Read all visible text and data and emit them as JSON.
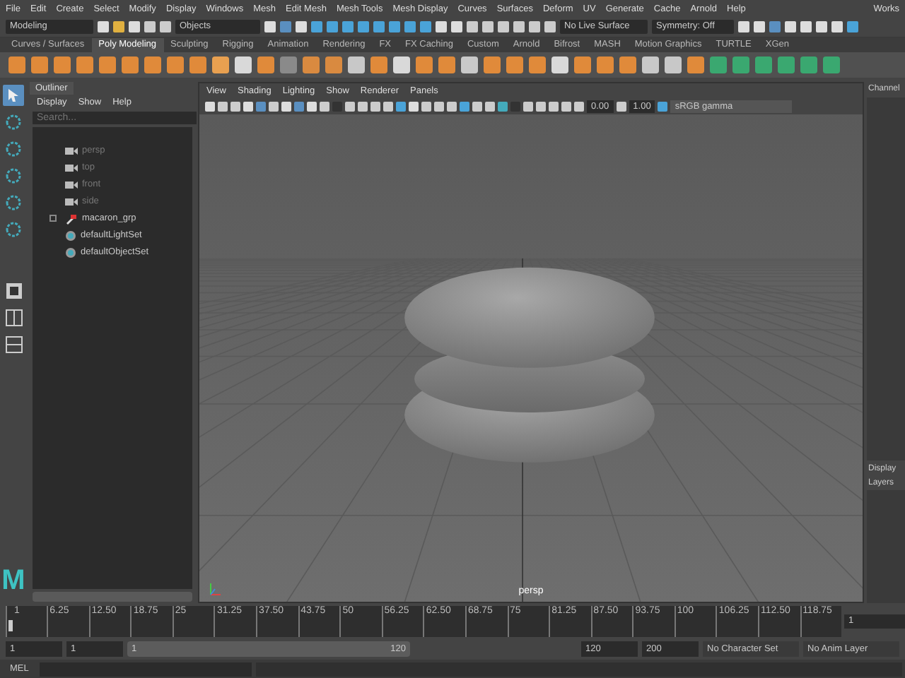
{
  "menu_bar": {
    "items": [
      "File",
      "Edit",
      "Create",
      "Select",
      "Modify",
      "Display",
      "Windows",
      "Mesh",
      "Edit Mesh",
      "Mesh Tools",
      "Mesh Display",
      "Curves",
      "Surfaces",
      "Deform",
      "UV",
      "Generate",
      "Cache",
      "Arnold",
      "Help"
    ],
    "workspace": "Works"
  },
  "status_line": {
    "menu_set": "Modeling",
    "selection_mode": "Objects",
    "live_surface": "No Live Surface",
    "symmetry": "Symmetry: Off"
  },
  "shelf": {
    "tabs": [
      {
        "label": "Curves / Surfaces",
        "selected": false
      },
      {
        "label": "Poly Modeling",
        "selected": true
      },
      {
        "label": "Sculpting",
        "selected": false
      },
      {
        "label": "Rigging",
        "selected": false
      },
      {
        "label": "Animation",
        "selected": false
      },
      {
        "label": "Rendering",
        "selected": false
      },
      {
        "label": "FX",
        "selected": false
      },
      {
        "label": "FX Caching",
        "selected": false
      },
      {
        "label": "Custom",
        "selected": false
      },
      {
        "label": "Arnold",
        "selected": false
      },
      {
        "label": "Bifrost",
        "selected": false
      },
      {
        "label": "MASH",
        "selected": false
      },
      {
        "label": "Motion Graphics",
        "selected": false
      },
      {
        "label": "TURTLE",
        "selected": false
      },
      {
        "label": "XGen",
        "selected": false
      }
    ]
  },
  "toolbox": {
    "tools": [
      {
        "selected": true
      },
      {
        "selected": false
      },
      {
        "selected": false
      },
      {
        "selected": false
      },
      {
        "selected": false
      },
      {
        "selected": false
      }
    ],
    "logo": "M"
  },
  "outliner": {
    "title": "Outliner",
    "menus": [
      "Display",
      "Show",
      "Help"
    ],
    "search_placeholder": "Search...",
    "items": [
      {
        "label": "persp",
        "kind": "camera",
        "dimmed": true
      },
      {
        "label": "top",
        "kind": "camera",
        "dimmed": true
      },
      {
        "label": "front",
        "kind": "camera",
        "dimmed": true
      },
      {
        "label": "side",
        "kind": "camera",
        "dimmed": true
      },
      {
        "label": "macaron_grp",
        "kind": "group",
        "dimmed": false
      },
      {
        "label": "defaultLightSet",
        "kind": "set",
        "dimmed": false
      },
      {
        "label": "defaultObjectSet",
        "kind": "set",
        "dimmed": false
      }
    ]
  },
  "viewport": {
    "menus": [
      "View",
      "Shading",
      "Lighting",
      "Show",
      "Renderer",
      "Panels"
    ],
    "exposure": "0.00",
    "gamma": "1.00",
    "color_space": "sRGB gamma",
    "camera_label": "persp"
  },
  "right_panel": {
    "channel_tab": "Channel",
    "display_tab": "Display",
    "layers_menu": "Layers"
  },
  "timeline": {
    "start_label": "1",
    "ticks": [
      "6.25",
      "12.50",
      "18.75",
      "25",
      "31.25",
      "37.50",
      "43.75",
      "50",
      "56.25",
      "62.50",
      "68.75",
      "75",
      "81.25",
      "87.50",
      "93.75",
      "100",
      "106.25",
      "112.50",
      "118.75"
    ],
    "current_frame": "1",
    "playhead": {
      "level": 0
    }
  },
  "range": {
    "start": "1",
    "playback_start": "1",
    "slider_start": "1",
    "slider_end": "120",
    "slider": {
      "level": 1
    },
    "playback_end": "120",
    "end": "200",
    "character_set": "No Character Set",
    "anim_layer": "No Anim Layer"
  },
  "command_line": {
    "language": "MEL"
  }
}
